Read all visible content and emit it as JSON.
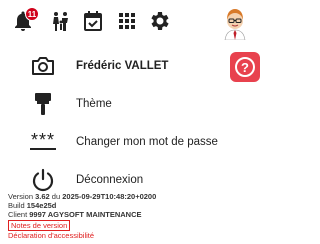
{
  "topbar": {
    "notifications_badge": "11",
    "icons": [
      "bell-icon",
      "family-icon",
      "calendar-check-icon",
      "apps-grid-icon",
      "gear-icon",
      "avatar"
    ]
  },
  "menu": {
    "items": [
      {
        "label": "Frédéric VALLET",
        "icon": "camera-icon"
      },
      {
        "label": "Thème",
        "icon": "paint-roller-icon"
      },
      {
        "label": "Changer mon mot de passe",
        "icon": "password-icon"
      },
      {
        "label": "Déconnexion",
        "icon": "power-icon"
      }
    ],
    "password_icon_text": "***"
  },
  "help": {
    "label": "?"
  },
  "footer": {
    "version_prefix": "Version ",
    "version": "3.62",
    "version_mid": " du ",
    "date": "2025-09-29T10:48:20+0200",
    "build_prefix": "Build ",
    "build": "154e25d",
    "client_prefix": "Client ",
    "client": "9997 AGYSOFT MAINTENANCE",
    "release_notes": "Notes de version",
    "accessibility": "Déclaration d'accessibilité"
  },
  "colors": {
    "accent_red": "#d0021b",
    "help_bg": "#e8424e",
    "link": "#e02020"
  }
}
